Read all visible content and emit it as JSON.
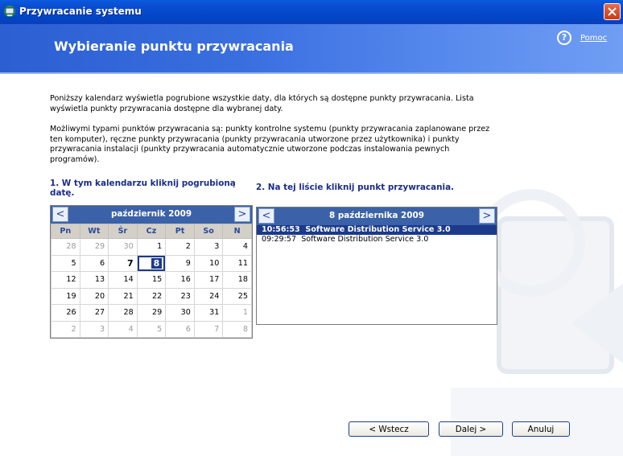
{
  "window": {
    "title": "Przywracanie systemu",
    "close_glyph": "✕"
  },
  "header": {
    "heading": "Wybieranie punktu przywracania",
    "help_glyph": "?",
    "help_link": "Pomoc"
  },
  "intro": {
    "p1": "Poniższy kalendarz wyświetla pogrubione wszystkie daty, dla których są dostępne punkty przywracania. Lista wyświetla punkty przywracania dostępne dla wybranej daty.",
    "p2": "Możliwymi typami punktów przywracania są: punkty kontrolne systemu (punkty przywracania zaplanowane przez ten komputer), ręczne punkty przywracania (punkty przywracania utworzone przez użytkownika) i punkty przywracania instalacji (punkty przywracania automatycznie utworzone podczas instalowania pewnych programów)."
  },
  "step1": {
    "label": "1. W tym kalendarzu kliknij pogrubioną datę."
  },
  "step2": {
    "label": "2. Na tej liście kliknij punkt przywracania."
  },
  "calendar": {
    "month": "październik 2009",
    "prev": "<",
    "next": ">",
    "weekdays": [
      "Pn",
      "Wt",
      "Śr",
      "Cz",
      "Pt",
      "So",
      "N"
    ],
    "weeks": [
      [
        "28",
        "29",
        "30",
        "1",
        "2",
        "3",
        "4"
      ],
      [
        "5",
        "6",
        "7",
        "8",
        "9",
        "10",
        "11"
      ],
      [
        "12",
        "13",
        "14",
        "15",
        "16",
        "17",
        "18"
      ],
      [
        "19",
        "20",
        "21",
        "22",
        "23",
        "24",
        "25"
      ],
      [
        "26",
        "27",
        "28",
        "29",
        "30",
        "31",
        "1"
      ],
      [
        "2",
        "3",
        "4",
        "5",
        "6",
        "7",
        "8"
      ]
    ]
  },
  "list": {
    "date": "8 października 2009",
    "prev": "<",
    "next": ">",
    "items": [
      {
        "time": "10:56:53",
        "name": "Software Distribution Service 3.0",
        "selected": true
      },
      {
        "time": "09:29:57",
        "name": "Software Distribution Service 3.0",
        "selected": false
      }
    ]
  },
  "buttons": {
    "back": "< Wstecz",
    "next": "Dalej >",
    "cancel": "Anuluj"
  },
  "colors": {
    "title_bar": "#0046c7",
    "banner": "#3a6fe0",
    "selection": "#1b3a8c",
    "calendar_header": "#3b62a8"
  }
}
